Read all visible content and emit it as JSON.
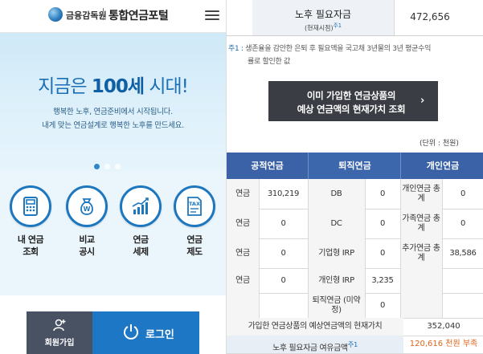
{
  "header": {
    "org_name": "금융감독원",
    "portal_title": "통합연금포털"
  },
  "hero": {
    "title_prefix": "지금은",
    "title_emphasis": "100세",
    "title_suffix": "시대!",
    "subtitle_line1": "행복한 노후, 연금준비에서 시작됩니다.",
    "subtitle_line2": "내게 맞는 연금설계로 행복한 노후를 만드세요.",
    "slide_count": 3,
    "active_slide": 1
  },
  "services": [
    {
      "line1": "내 연금",
      "line2": "조회",
      "icon": "calculator-icon"
    },
    {
      "line1": "비교",
      "line2": "공시",
      "icon": "money-bag-icon"
    },
    {
      "line1": "연금",
      "line2": "세제",
      "icon": "growth-chart-icon"
    },
    {
      "line1": "연금",
      "line2": "제도",
      "icon": "tax-document-icon"
    }
  ],
  "auth": {
    "join_label": "회원가입",
    "login_label": "로그인"
  },
  "summary": {
    "need_label": "노후 필요자금",
    "need_sublabel": "(현재시점)",
    "need_sup": "주1",
    "need_value": "472,656"
  },
  "note": {
    "tag": "주1 :",
    "line1": "생존율을 감안한 은퇴 후 필요액을 국고채 3년물의 3년 평균수익",
    "line2": "률로 할인한 값"
  },
  "query_button": {
    "line1": "이미 가입한 연금상품의",
    "line2": "예상 연금액의 현재가치 조회",
    "arrow": "›"
  },
  "unit_label": "(단위 : 천원)",
  "table": {
    "headers": [
      "공적연금",
      "퇴직연금",
      "개인연금"
    ],
    "rows": [
      {
        "public_label": "연금",
        "public_value": "310,219",
        "retire_label": "DB",
        "retire_value": "0",
        "personal_label": "개인연금 총계",
        "personal_value": "0"
      },
      {
        "public_label": "연금",
        "public_value": "0",
        "retire_label": "DC",
        "retire_value": "0",
        "personal_label": "가족연금 총계",
        "personal_value": "0"
      },
      {
        "public_label": "연금",
        "public_value": "0",
        "retire_label": "기업형 IRP",
        "retire_value": "0",
        "personal_label": "추가연금 총계",
        "personal_value": "38,586"
      },
      {
        "public_label": "연금",
        "public_value": "0",
        "retire_label": "개인형 IRP",
        "retire_value": "3,235",
        "personal_label": "",
        "personal_value": ""
      },
      {
        "public_label": "",
        "public_value": "",
        "retire_label": "퇴직연금 (미약정)",
        "retire_value": "0",
        "personal_label": "",
        "personal_value": ""
      }
    ],
    "total_label": "가입한 연금상품의 예상연금액의 현재가치",
    "total_value": "352,040",
    "shortfall_label": "노후 필요자금 여유금액",
    "shortfall_sup": "주1",
    "shortfall_value": "120,616 천원 부족"
  },
  "colors": {
    "brand_blue": "#1d77c4",
    "table_header": "#3b62a6",
    "shortfall": "#e2651c"
  }
}
